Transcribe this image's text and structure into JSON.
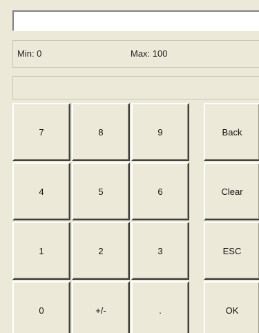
{
  "input": {
    "value": ""
  },
  "range": {
    "min_label": "Min: 0",
    "max_label": "Max: 100"
  },
  "message": {
    "text": ""
  },
  "keypad": {
    "keys": [
      {
        "label": "7"
      },
      {
        "label": "8"
      },
      {
        "label": "9"
      },
      {
        "label": "Back"
      },
      {
        "label": "4"
      },
      {
        "label": "5"
      },
      {
        "label": "6"
      },
      {
        "label": "Clear"
      },
      {
        "label": "1"
      },
      {
        "label": "2"
      },
      {
        "label": "3"
      },
      {
        "label": "ESC"
      },
      {
        "label": "0"
      },
      {
        "label": "+/-"
      },
      {
        "label": "."
      },
      {
        "label": "OK"
      }
    ]
  },
  "colors": {
    "background": "#ece9d8",
    "input_background": "#ffffff"
  }
}
